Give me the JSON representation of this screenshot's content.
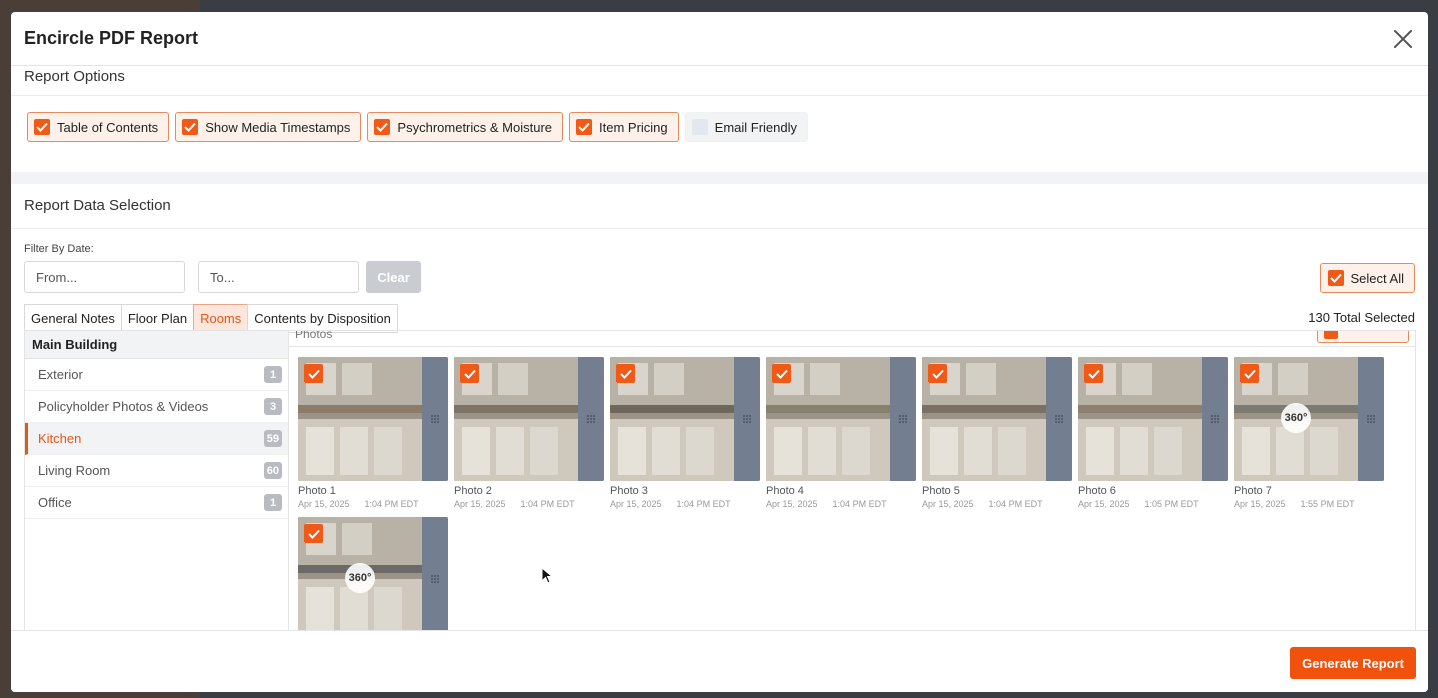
{
  "modal": {
    "title": "Encircle PDF Report"
  },
  "report_options": {
    "title": "Report Options",
    "options": [
      {
        "label": "Table of Contents",
        "checked": true
      },
      {
        "label": "Show Media Timestamps",
        "checked": true
      },
      {
        "label": "Psychrometrics & Moisture",
        "checked": true
      },
      {
        "label": "Item Pricing",
        "checked": true
      },
      {
        "label": "Email Friendly",
        "checked": false
      }
    ]
  },
  "data_selection": {
    "title": "Report Data Selection",
    "filter_label": "Filter By Date:",
    "from_placeholder": "From...",
    "to_placeholder": "To...",
    "clear_label": "Clear",
    "select_all_label": "Select All",
    "total_selected": "130 Total Selected",
    "tabs": [
      {
        "label": "General Notes",
        "active": false
      },
      {
        "label": "Floor Plan",
        "active": false
      },
      {
        "label": "Rooms",
        "active": true
      },
      {
        "label": "Contents by Disposition",
        "active": false
      }
    ]
  },
  "sidebar": {
    "header": "Main Building",
    "items": [
      {
        "label": "Exterior",
        "count": "1",
        "active": false
      },
      {
        "label": "Policyholder Photos & Videos",
        "count": "3",
        "active": false
      },
      {
        "label": "Kitchen",
        "count": "59",
        "active": true
      },
      {
        "label": "Living Room",
        "count": "60",
        "active": false
      },
      {
        "label": "Office",
        "count": "1",
        "active": false
      }
    ]
  },
  "photos": {
    "header": "Photos",
    "select_all_label": "Select All",
    "items": [
      {
        "title": "Photo 1",
        "date": "Apr 15, 2025",
        "time": "1:04 PM EDT",
        "pano": false,
        "checked": true
      },
      {
        "title": "Photo 2",
        "date": "Apr 15, 2025",
        "time": "1:04 PM EDT",
        "pano": false,
        "checked": true
      },
      {
        "title": "Photo 3",
        "date": "Apr 15, 2025",
        "time": "1:04 PM EDT",
        "pano": false,
        "checked": true
      },
      {
        "title": "Photo 4",
        "date": "Apr 15, 2025",
        "time": "1:04 PM EDT",
        "pano": false,
        "checked": true
      },
      {
        "title": "Photo 5",
        "date": "Apr 15, 2025",
        "time": "1:04 PM EDT",
        "pano": false,
        "checked": true
      },
      {
        "title": "Photo 6",
        "date": "Apr 15, 2025",
        "time": "1:05 PM EDT",
        "pano": false,
        "checked": true
      },
      {
        "title": "Photo 7",
        "date": "Apr 15, 2025",
        "time": "1:55 PM EDT",
        "pano": true,
        "checked": true
      },
      {
        "title": "",
        "date": "",
        "time": "",
        "pano": true,
        "checked": true
      }
    ],
    "pano_label": "360°"
  },
  "footer": {
    "generate_label": "Generate Report"
  },
  "colors": {
    "accent": "#f15a16",
    "accent_bg": "#fdf1ea",
    "handle": "#737f90"
  }
}
